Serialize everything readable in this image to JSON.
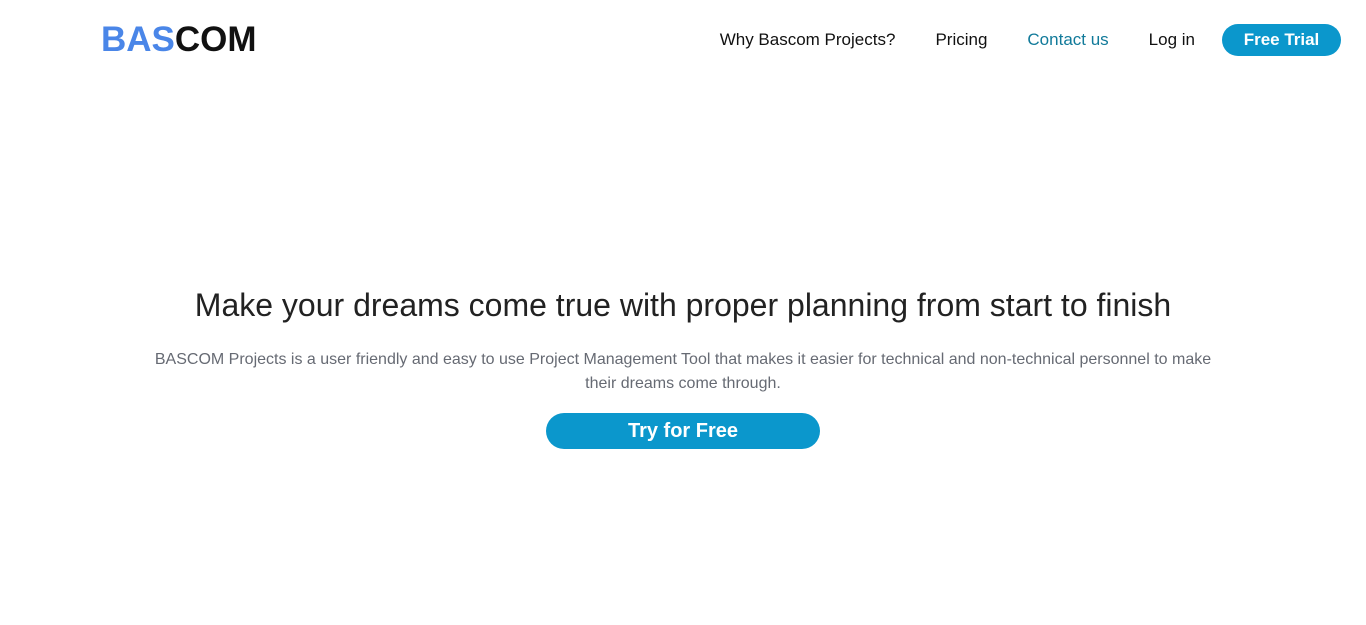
{
  "brand": {
    "logo_part_a": "BAS",
    "logo_part_b": "COM",
    "accent_color": "#4a86e8",
    "button_color": "#0b97cc",
    "active_link_color": "#117a9a"
  },
  "nav": {
    "why_label": "Why Bascom Projects?",
    "pricing_label": "Pricing",
    "contact_label": "Contact us",
    "login_label": "Log in",
    "trial_label": "Free Trial"
  },
  "hero": {
    "title": "Make your dreams come true with proper planning from start to finish",
    "description": "BASCOM Projects is a user friendly and easy to use Project Management Tool that makes it easier for technical and non-technical personnel to make their dreams come through.",
    "cta_label": "Try for Free"
  }
}
